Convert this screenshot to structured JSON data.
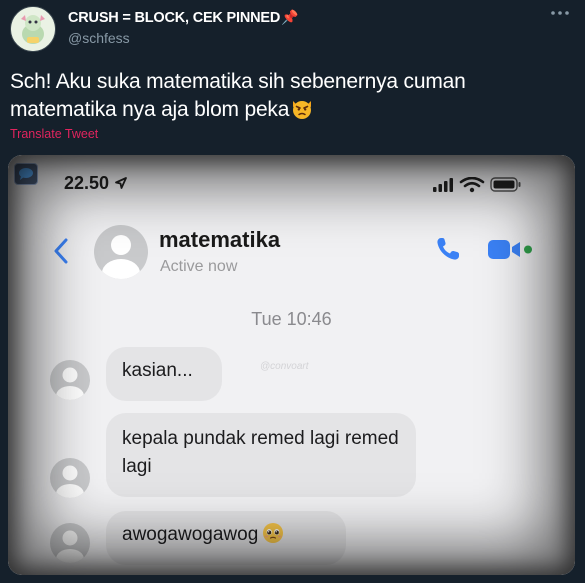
{
  "tweet": {
    "author": {
      "display_name": "CRUSH = BLOCK, CEK PINNED",
      "display_name_emoji": "pushpin-icon",
      "handle": "@schfess"
    },
    "more_icon": "more-dots-icon",
    "text": "Sch! Aku suka matematika sih sebenernya cuman matematika nya aja blom peka",
    "text_emoji": "pouting-cat-emoji",
    "translate_label": "Translate Tweet"
  },
  "screenshot": {
    "status_bar": {
      "time": "22.50",
      "icons": [
        "location-arrow-icon",
        "signal-bars-icon",
        "wifi-icon",
        "battery-icon"
      ]
    },
    "chat_header": {
      "name": "matematika",
      "status": "Active now",
      "back_icon": "chevron-left-icon",
      "call_icon": "phone-icon",
      "video_icon": "video-camera-icon"
    },
    "timestamp": "Tue 10:46",
    "watermark": "@convoart",
    "messages": [
      {
        "text": "kasian...",
        "emoji": ""
      },
      {
        "text": "kepala pundak remed lagi remed lagi",
        "emoji": ""
      },
      {
        "text": "awogawogawog",
        "emoji": "pleading-face-emoji"
      }
    ]
  },
  "colors": {
    "background": "#15202b",
    "secondary_text": "#8899a6",
    "translate_link": "#e0245e",
    "messenger_blue": "#3b82f6",
    "active_dot": "#31a24c"
  }
}
